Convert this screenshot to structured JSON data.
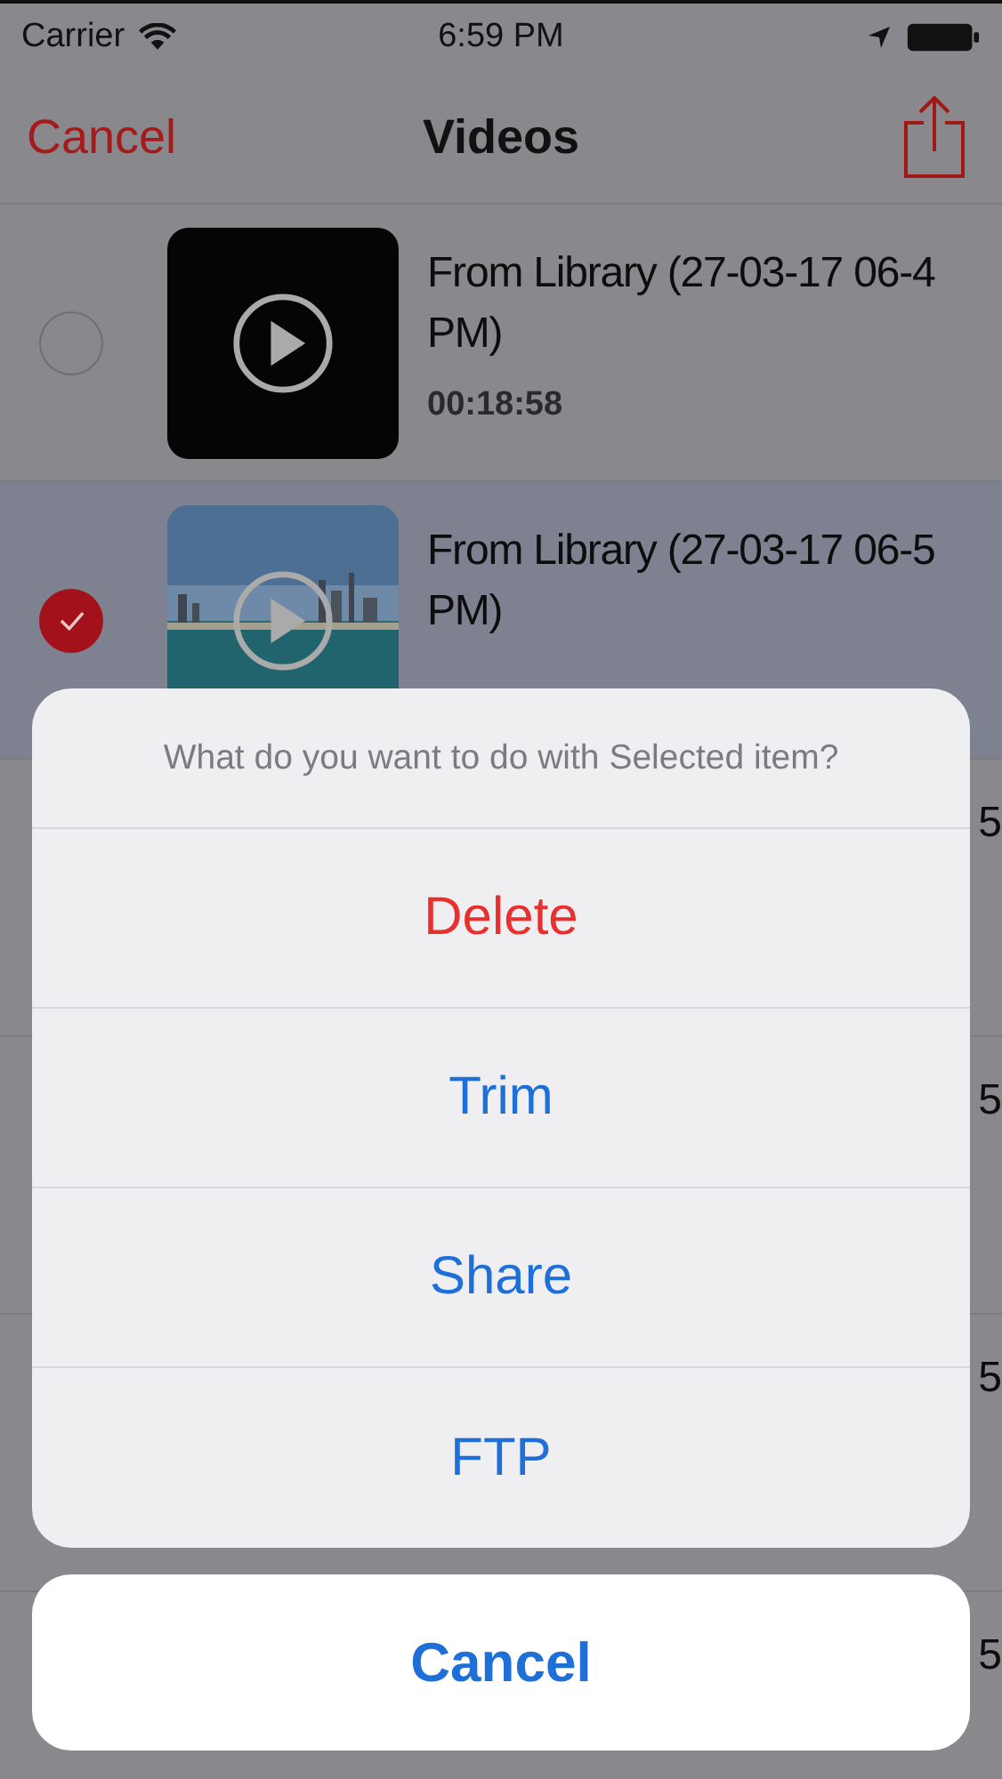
{
  "status_bar": {
    "carrier": "Carrier",
    "time": "6:59 PM"
  },
  "nav": {
    "left_button": "Cancel",
    "title": "Videos"
  },
  "videos": [
    {
      "title": "From Library (27-03-17 06-4\nPM)",
      "duration": "00:18:58",
      "selected": false
    },
    {
      "title": "From Library (27-03-17 06-5\nPM)",
      "selected": true,
      "kind": "picture"
    }
  ],
  "covered_rows": [
    {
      "title_end": "5"
    },
    {
      "title_end": "5"
    },
    {
      "title_end": "5"
    },
    {
      "title_end": "5"
    }
  ],
  "action_sheet": {
    "message": "What do you want to do with Selected item?",
    "actions": [
      {
        "label": "Delete",
        "kind": "destructive"
      },
      {
        "label": "Trim",
        "kind": "default"
      },
      {
        "label": "Share",
        "kind": "default"
      },
      {
        "label": "FTP",
        "kind": "default"
      }
    ],
    "cancel": "Cancel"
  }
}
